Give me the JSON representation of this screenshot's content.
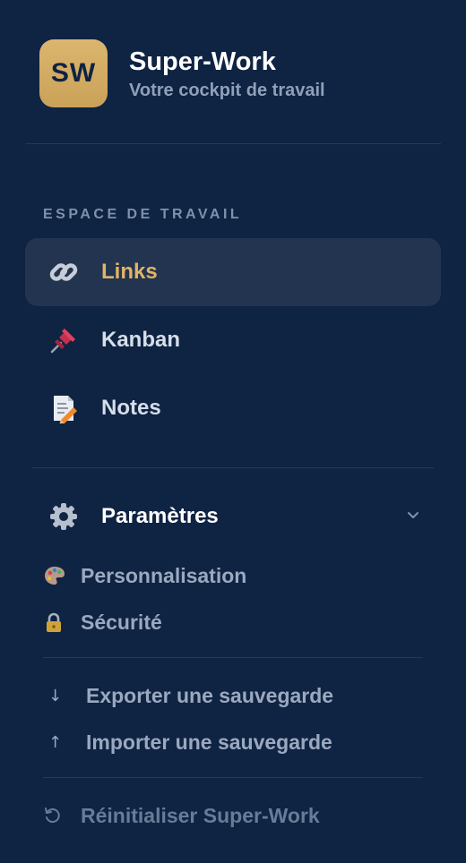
{
  "brand": {
    "logo_text": "SW",
    "title": "Super-Work",
    "subtitle": "Votre cockpit de travail",
    "accent": "#d6b06a"
  },
  "sidebar": {
    "section_label": "ESPACE DE TRAVAIL",
    "active_color": "#e1b466",
    "items": [
      {
        "label": "Links",
        "icon": "link-icon",
        "active": true
      },
      {
        "label": "Kanban",
        "icon": "pushpin-icon",
        "active": false
      },
      {
        "label": "Notes",
        "icon": "memo-icon",
        "active": false
      }
    ]
  },
  "settings": {
    "label": "Paramètres",
    "icon": "gear-icon",
    "expanded": true,
    "items": [
      {
        "label": "Personnalisation",
        "icon": "palette-icon"
      },
      {
        "label": "Sécurité",
        "icon": "lock-icon"
      }
    ],
    "backup": [
      {
        "label": "Exporter une sauvegarde",
        "icon": "arrow-down-icon",
        "glyph": "↓"
      },
      {
        "label": "Importer une sauvegarde",
        "icon": "arrow-up-icon",
        "glyph": "↑"
      }
    ],
    "reset": {
      "label": "Réinitialiser Super-Work",
      "icon": "reset-icon"
    }
  }
}
